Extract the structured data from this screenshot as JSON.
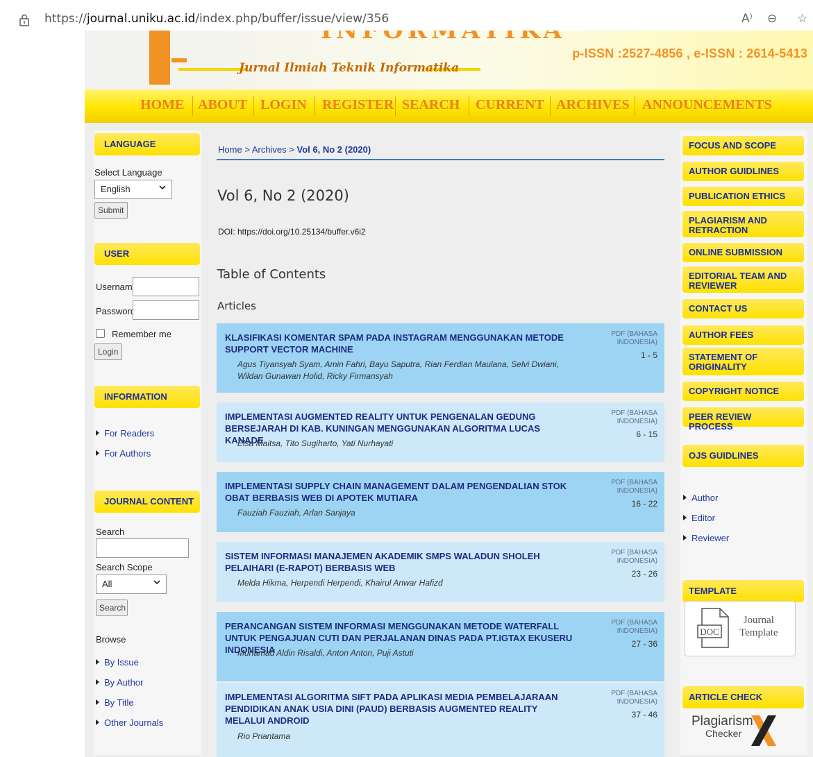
{
  "browser": {
    "url_prefix": "https://",
    "url_domain": "journal.uniku.ac.id",
    "url_path": "/index.php/buffer/issue/view/356",
    "read_aloud_icon": "A⁾",
    "zoom_icon": "⊖",
    "favorite_icon": "☆"
  },
  "masthead": {
    "title_partial": "INFORMATIKA",
    "subtitle": "Jurnal Ilmiah Teknik Informatika",
    "issn": "p-ISSN :2527-4856 , e-ISSN : 2614-5413"
  },
  "nav": [
    "HOME",
    "ABOUT",
    "LOGIN",
    "REGISTER",
    "SEARCH",
    "CURRENT",
    "ARCHIVES",
    "ANNOUNCEMENTS"
  ],
  "left": {
    "language": {
      "title": "LANGUAGE",
      "select_label": "Select Language",
      "selected": "English",
      "submit": "Submit"
    },
    "user": {
      "title": "USER",
      "username_label": "Username",
      "password_label": "Password",
      "remember_label": "Remember me",
      "login": "Login"
    },
    "information": {
      "title": "INFORMATION",
      "links": [
        "For Readers",
        "For Authors"
      ]
    },
    "journal_content": {
      "title": "JOURNAL CONTENT",
      "search_label": "Search",
      "scope_label": "Search Scope",
      "scope_selected": "All",
      "search_button": "Search",
      "browse_label": "Browse",
      "browse_links": [
        "By Issue",
        "By Author",
        "By Title",
        "Other Journals"
      ]
    }
  },
  "main": {
    "breadcrumb": {
      "home": "Home",
      "sep": ">",
      "archives": "Archives",
      "current": "Vol 6, No 2 (2020)"
    },
    "title": "Vol 6, No 2 (2020)",
    "doi": "DOI: https://doi.org/10.25134/buffer.v6i2",
    "toc_heading": "Table of Contents",
    "section": "Articles",
    "articles": [
      {
        "title": "KLASIFIKASI KOMENTAR SPAM PADA INSTAGRAM MENGGUNAKAN METODE SUPPORT VECTOR MACHINE",
        "authors": "Agus Tiyansyah Syam, Amin Fahri, Bayu Saputra, Rian Ferdian Maulana, Selvi Dwiani, Wildan Gunawan Holid, Ricky Firmansyah",
        "pdf": "PDF (BAHASA INDONESIA)",
        "pages": "1 - 5"
      },
      {
        "title": "IMPLEMENTASI AUGMENTED REALITY UNTUK PENGENALAN GEDUNG BERSEJARAH DI KAB. KUNINGAN MENGGUNAKAN ALGORITMA LUCAS KANADE",
        "authors": "Elsa Maitsa, Tito Sugiharto, Yati Nurhayati",
        "pdf": "PDF (BAHASA INDONESIA)",
        "pages": "6 - 15"
      },
      {
        "title": "IMPLEMENTASI SUPPLY CHAIN MANAGEMENT DALAM PENGENDALIAN STOK OBAT BERBASIS WEB DI APOTEK MUTIARA",
        "authors": "Fauziah Fauziah, Arlan Sanjaya",
        "pdf": "PDF (BAHASA INDONESIA)",
        "pages": "16 - 22"
      },
      {
        "title": "SISTEM INFORMASI MANAJEMEN AKADEMIK SMPS WALADUN SHOLEH PELAIHARI (E-RAPOT) BERBASIS WEB",
        "authors": "Melda Hikma, Herpendi Herpendi, Khairul Anwar Hafizd",
        "pdf": "PDF (BAHASA INDONESIA)",
        "pages": "23 - 26"
      },
      {
        "title": "PERANCANGAN SISTEM INFORMASI MENGGUNAKAN METODE WATERFALL UNTUK PENGAJUAN CUTI DAN PERJALANAN DINAS PADA PT.IGTAX EKUSERU INDONESIA",
        "authors": "Muhamad Aldin Risaldi, Anton Anton, Puji Astuti",
        "pdf": "PDF (BAHASA INDONESIA)",
        "pages": "27 - 36"
      },
      {
        "title": "IMPLEMENTASI ALGORITMA SIFT PADA APLIKASI MEDIA PEMBELAJARAAN PENDIDIKAN ANAK USIA DINI (PAUD) BERBASIS AUGMENTED REALITY MELALUI ANDROID",
        "authors": "Rio Priantama",
        "pdf": "PDF (BAHASA INDONESIA)",
        "pages": "37 - 46"
      }
    ]
  },
  "right": {
    "links": [
      "FOCUS AND SCOPE",
      "AUTHOR GUIDLINES",
      "PUBLICATION ETHICS",
      "PLAGIARISM AND RETRACTION",
      "ONLINE SUBMISSION",
      "EDITORIAL TEAM AND REVIEWER",
      "CONTACT US",
      "AUTHOR FEES",
      "STATEMENT OF ORIGINALITY",
      "COPYRIGHT NOTICE",
      "PEER REVIEW PROCESS"
    ],
    "ojs": {
      "title": "OJS GUIDLINES",
      "links": [
        "Author",
        "Editor",
        "Reviewer"
      ]
    },
    "template": {
      "title": "TEMPLATE",
      "doc_label": "DOC",
      "text_line1": "Journal",
      "text_line2": "Template"
    },
    "article_check": {
      "title": "ARTICLE CHECK",
      "brand": "Plagiarism",
      "brand_sub": "Checker"
    }
  },
  "colors": {
    "nav_text": "#ee7f1b",
    "block_title": "#1a2f9a",
    "block_bg": "#ffe100",
    "article_dark": "#9dd4f3",
    "article_light": "#cde9f9",
    "accent_orange": "#f39224"
  }
}
